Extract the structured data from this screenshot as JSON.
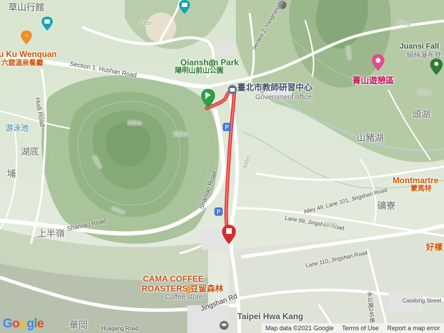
{
  "labels": {
    "caoshan_house": "草山行館",
    "kuku": "u Ku Wenquan",
    "kuku_cn": "六窟溫泉餐廳",
    "qianshan_park": "Qianshan Park",
    "qianshan_park_cn": "陽明山前山公園",
    "section1_hushan": "Section 1, Hushan Road",
    "section2_yangming": "Section 2, Yangming Road",
    "hudi_road": "Hudi Road",
    "pool": "游泳池",
    "hudi": "湖底",
    "bu": "埔",
    "teacher_center": "臺北市教師研習中心",
    "gov_office": "Government office",
    "shanzhuhu": "山豬湖",
    "touhu": "頭湖",
    "juansi_falls": "Juansi Fall",
    "juansi_falls_cn": "絹絲瀑布登",
    "qingshan": "菁山遊憩區",
    "montmartre": "Montmartre",
    "montmartre_cn": "蒙馬特",
    "kuliao": "礦寮",
    "hao": "好樣",
    "shamao_road": "Shamao Road",
    "shamao_road2": "Shamao Road",
    "shangbanling": "上半嶺",
    "alley49": "Alley 49, Lane 101, Jingshan Road",
    "lane99": "Lane 99, Jingshan Road",
    "lane110": "Lane 110, Jingshan Road",
    "jingshan_road": "Jingshan Rd",
    "cama1": "CAMA COFFEE",
    "cama2": "ROASTERS 豆留森林",
    "cama3": "Coffee store",
    "taipei_hwakang": "Taipei Hwa Kang",
    "huagang": "華岡",
    "huagang_road": "Huagang Road",
    "caodong": "Caodong Street",
    "yongming": "永公路245巷34",
    "c600a": "600m",
    "c600b": "600m",
    "c500a": "500m",
    "c500b": "500m",
    "c400a": "400m",
    "c400b": "400m",
    "c400c": "400m",
    "c600c": "600m",
    "c500c": "500m",
    "c600d": "600m"
  },
  "attribution": {
    "map_data": "Map data ©2021 Google",
    "terms": "Terms of Use",
    "report": "Report a map error"
  },
  "google_logo": "Google",
  "icons": [
    "restaurant-icon",
    "camera-icon",
    "start-pin-icon",
    "government-icon",
    "parking-icon",
    "end-pin-icon",
    "education-icon",
    "park-icon",
    "attraction-icon"
  ],
  "colors": {
    "route": "#ee4444",
    "terrain": "#cfe0c4",
    "road": "#ffffff"
  }
}
